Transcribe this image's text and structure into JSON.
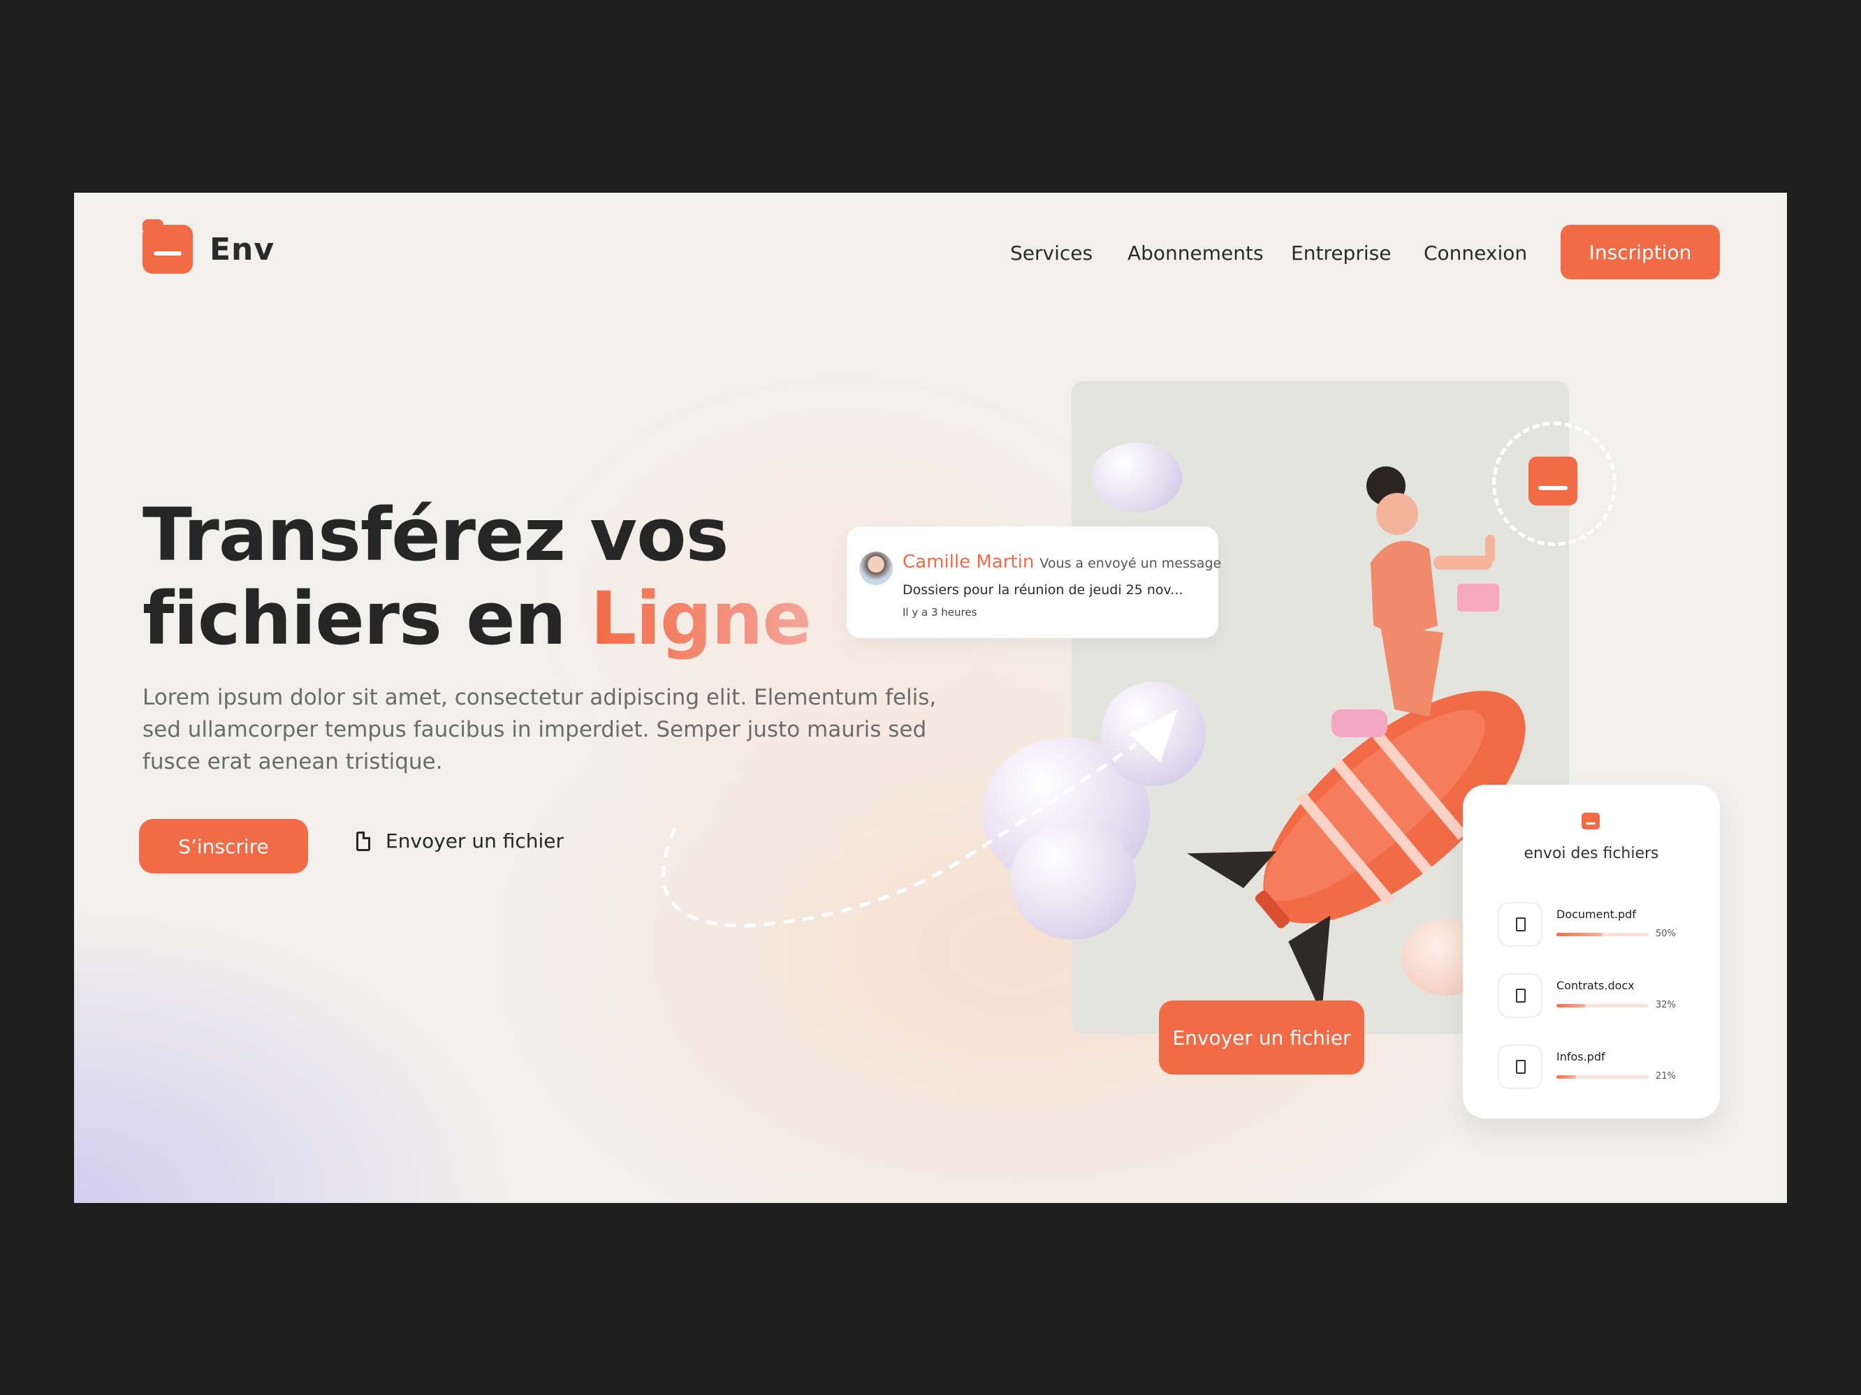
{
  "brand": {
    "name": "Env",
    "accent_color": "#f26b47"
  },
  "nav": {
    "items": [
      "Services",
      "Abonnements",
      "Entreprise",
      "Connexion"
    ],
    "signup_label": "Inscription"
  },
  "hero": {
    "title_line1": "Transférez vos",
    "title_line2_prefix": "fichiers en ",
    "title_accent": "Ligne",
    "description": "Lorem ipsum dolor sit amet, consectetur adipiscing elit. Elementum felis, sed ullamcorper tempus faucibus in imperdiet. Semper justo mauris sed fusce erat aenean tristique.",
    "primary_button": "S’inscrire",
    "secondary_link": "Envoyer un fichier"
  },
  "message_card": {
    "sender": "Camille Martin",
    "action": "Vous a envoyé un message",
    "text": "Dossiers pour la réunion de jeudi 25 nov...",
    "time": "Il y a 3 heures"
  },
  "send_button": "Envoyer un fichier",
  "upload_card": {
    "title": "envoi des fichiers",
    "files": [
      {
        "name": "Document.pdf",
        "progress": 50,
        "label": "50%"
      },
      {
        "name": "Contrats.docx",
        "progress": 32,
        "label": "32%"
      },
      {
        "name": "Infos.pdf",
        "progress": 21,
        "label": "21%"
      }
    ]
  }
}
